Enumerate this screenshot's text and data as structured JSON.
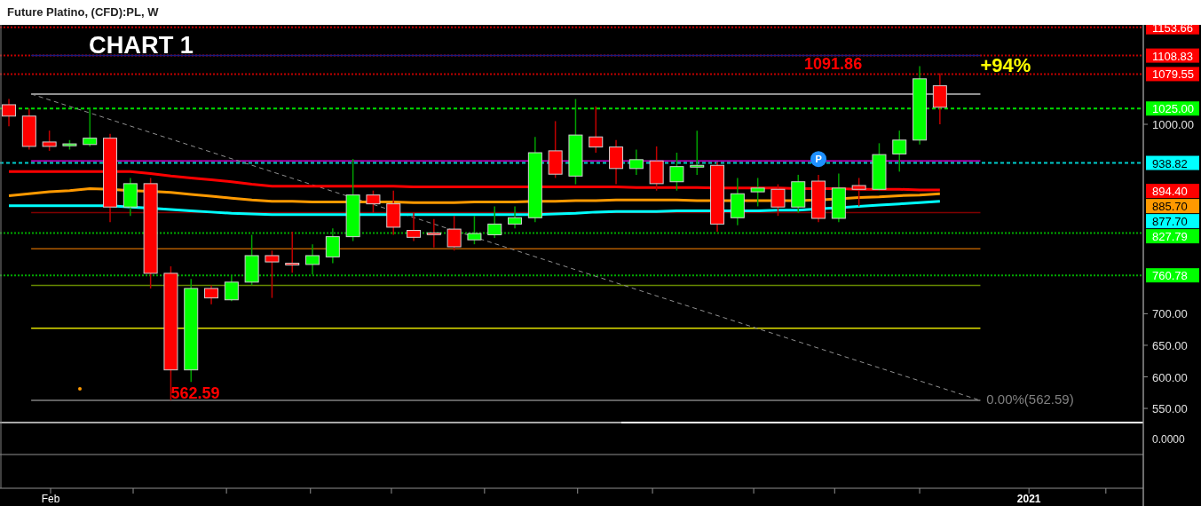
{
  "window": {
    "title": "Future Platino, (CFD):PL, W"
  },
  "chart": {
    "heading": "CHART 1",
    "price_labels": [
      {
        "text": "1153.66",
        "color": "#ff0000"
      },
      {
        "text": "1108.83",
        "color": "#ff0000"
      },
      {
        "text": "1079.55",
        "color": "#ff0000"
      },
      {
        "text": "1025.00",
        "color": "#00ff00"
      },
      {
        "text": "938.82",
        "color": "#00ffff"
      },
      {
        "text": "894.40",
        "color": "#ff0000"
      },
      {
        "text": "885.70",
        "color": "#ff9900"
      },
      {
        "text": "877.70",
        "color": "#00ffff"
      },
      {
        "text": "827.79",
        "color": "#00ff00"
      },
      {
        "text": "760.78",
        "color": "#00ff00"
      }
    ],
    "axis_labels": [
      "1000.00",
      "700.00",
      "650.00",
      "600.00",
      "550.00"
    ],
    "annotations": [
      "1091.86",
      "+94%",
      "562.59",
      "0.00%(562.59)"
    ],
    "marker": "P",
    "x_labels": [
      "Feb",
      "2021"
    ]
  },
  "indicator_pane": {
    "reading": "0.0000"
  }
}
